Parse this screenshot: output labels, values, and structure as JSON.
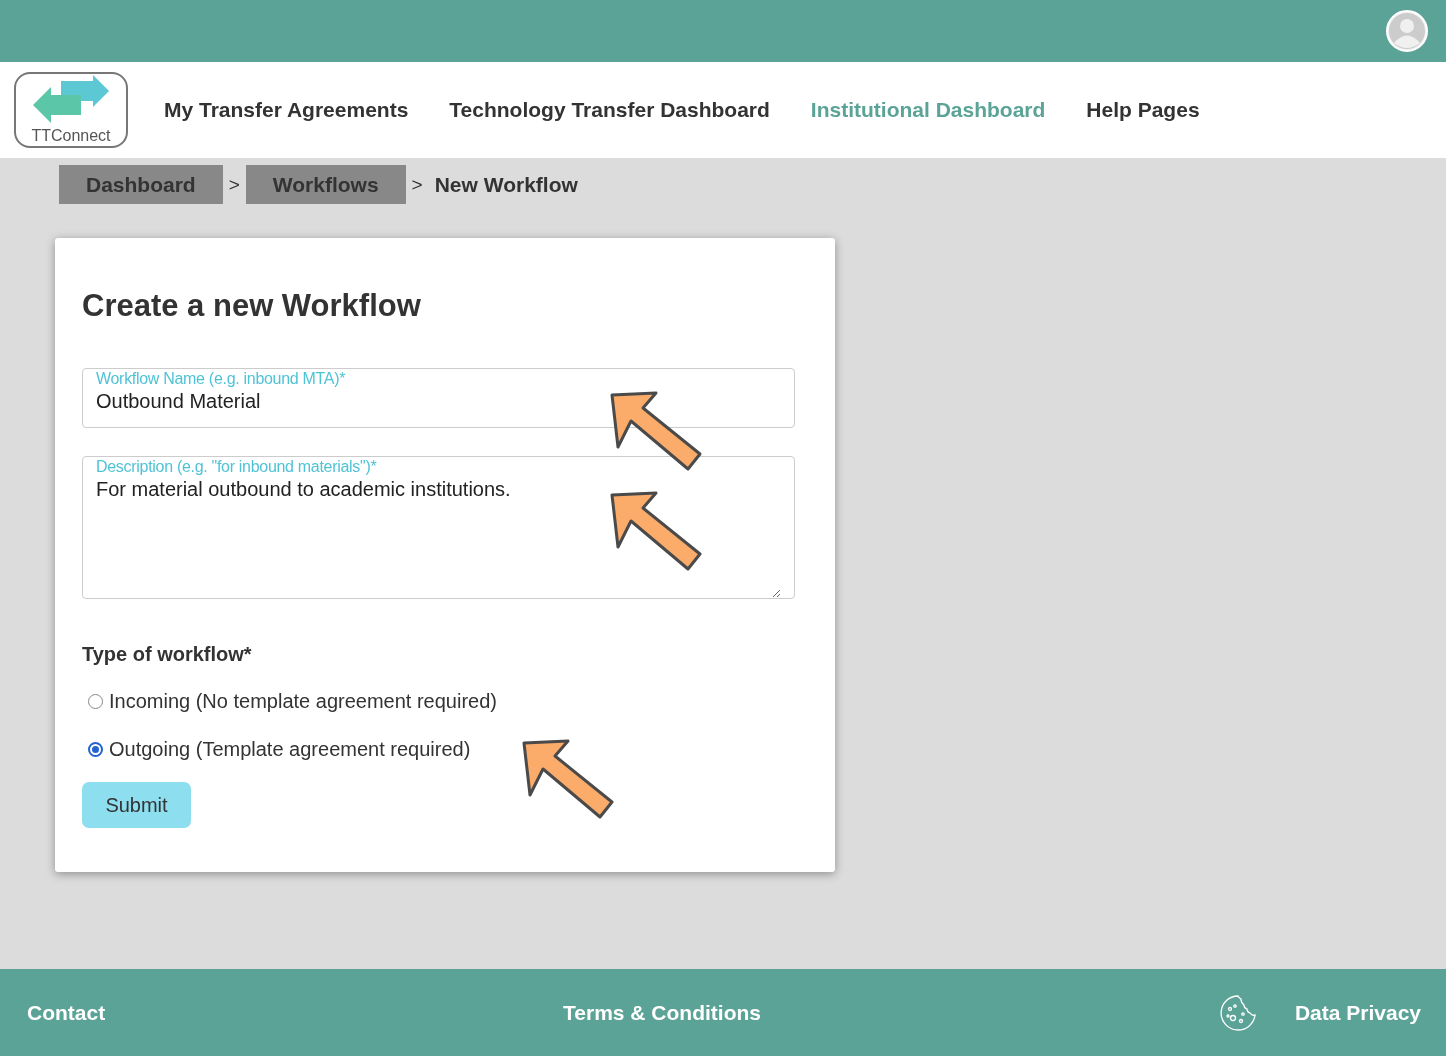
{
  "nav": {
    "logo_text": "TTConnect",
    "items": [
      {
        "label": "My Transfer Agreements",
        "selected": false
      },
      {
        "label": "Technology Transfer Dashboard",
        "selected": false
      },
      {
        "label": "Institutional Dashboard",
        "selected": true
      },
      {
        "label": "Help Pages",
        "selected": false
      }
    ]
  },
  "breadcrumb": {
    "links": [
      "Dashboard",
      "Workflows"
    ],
    "separator": ">",
    "current": "New Workflow"
  },
  "form": {
    "title": "Create a new Workflow",
    "name_field": {
      "label": "Workflow Name (e.g. inbound MTA)*",
      "value": "Outbound Material"
    },
    "description_field": {
      "label": "Description (e.g. \"for inbound materials\")*",
      "value": "For material outbound to academic institutions."
    },
    "type_label": "Type of workflow*",
    "options": [
      {
        "label": "Incoming (No template agreement required)",
        "selected": false
      },
      {
        "label": "Outgoing (Template agreement required)",
        "selected": true
      }
    ],
    "submit": "Submit"
  },
  "footer": {
    "contact": "Contact",
    "terms": "Terms & Conditions",
    "privacy": "Data Privacy"
  }
}
